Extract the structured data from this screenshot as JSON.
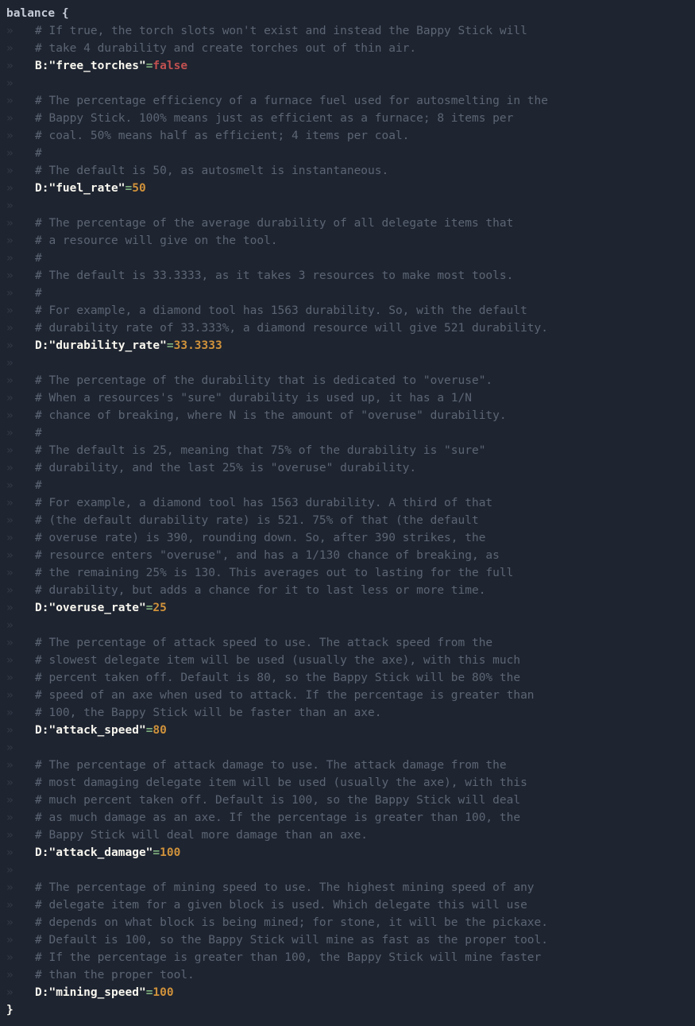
{
  "ws_marker": "»",
  "section_open": "balance {",
  "section_close": "}",
  "entries": [
    {
      "comments": [
        "# If true, the torch slots won't exist and instead the Bappy Stick will",
        "# take 4 durability and create torches out of thin air."
      ],
      "type": "B:",
      "key": "\"free_torches\"",
      "eq": "=",
      "value": "false",
      "value_kind": "bool"
    },
    {
      "comments": [
        "# The percentage efficiency of a furnace fuel used for autosmelting in the",
        "# Bappy Stick. 100% means just as efficient as a furnace; 8 items per",
        "# coal. 50% means half as efficient; 4 items per coal.",
        "#",
        "# The default is 50, as autosmelt is instantaneous."
      ],
      "type": "D:",
      "key": "\"fuel_rate\"",
      "eq": "=",
      "value": "50",
      "value_kind": "num"
    },
    {
      "comments": [
        "# The percentage of the average durability of all delegate items that",
        "# a resource will give on the tool.",
        "#",
        "# The default is 33.3333, as it takes 3 resources to make most tools.",
        "#",
        "# For example, a diamond tool has 1563 durability. So, with the default",
        "# durability rate of 33.333%, a diamond resource will give 521 durability."
      ],
      "type": "D:",
      "key": "\"durability_rate\"",
      "eq": "=",
      "value": "33.3333",
      "value_kind": "num"
    },
    {
      "comments": [
        "# The percentage of the durability that is dedicated to \"overuse\".",
        "# When a resources's \"sure\" durability is used up, it has a 1/N",
        "# chance of breaking, where N is the amount of \"overuse\" durability.",
        "#",
        "# The default is 25, meaning that 75% of the durability is \"sure\"",
        "# durability, and the last 25% is \"overuse\" durability.",
        "#",
        "# For example, a diamond tool has 1563 durability. A third of that",
        "# (the default durability rate) is 521. 75% of that (the default",
        "# overuse rate) is 390, rounding down. So, after 390 strikes, the",
        "# resource enters \"overuse\", and has a 1/130 chance of breaking, as",
        "# the remaining 25% is 130. This averages out to lasting for the full",
        "# durability, but adds a chance for it to last less or more time."
      ],
      "type": "D:",
      "key": "\"overuse_rate\"",
      "eq": "=",
      "value": "25",
      "value_kind": "num"
    },
    {
      "comments": [
        "# The percentage of attack speed to use. The attack speed from the",
        "# slowest delegate item will be used (usually the axe), with this much",
        "# percent taken off. Default is 80, so the Bappy Stick will be 80% the",
        "# speed of an axe when used to attack. If the percentage is greater than",
        "# 100, the Bappy Stick will be faster than an axe."
      ],
      "type": "D:",
      "key": "\"attack_speed\"",
      "eq": "=",
      "value": "80",
      "value_kind": "num"
    },
    {
      "comments": [
        "# The percentage of attack damage to use. The attack damage from the",
        "# most damaging delegate item will be used (usually the axe), with this",
        "# much percent taken off. Default is 100, so the Bappy Stick will deal",
        "# as much damage as an axe. If the percentage is greater than 100, the",
        "# Bappy Stick will deal more damage than an axe."
      ],
      "type": "D:",
      "key": "\"attack_damage\"",
      "eq": "=",
      "value": "100",
      "value_kind": "num"
    },
    {
      "comments": [
        "# The percentage of mining speed to use. The highest mining speed of any",
        "# delegate item for a given block is used. Which delegate this will use",
        "# depends on what block is being mined; for stone, it will be the pickaxe.",
        "# Default is 100, so the Bappy Stick will mine as fast as the proper tool.",
        "# If the percentage is greater than 100, the Bappy Stick will mine faster",
        "# than the proper tool."
      ],
      "type": "D:",
      "key": "\"mining_speed\"",
      "eq": "=",
      "value": "100",
      "value_kind": "num"
    }
  ]
}
